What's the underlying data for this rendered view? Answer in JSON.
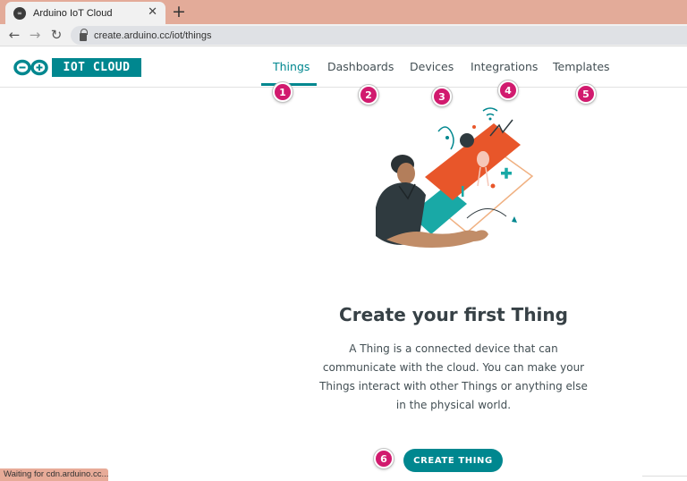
{
  "browser": {
    "tab_title": "Arduino IoT Cloud",
    "favicon_text": "∞",
    "close_glyph": "✕",
    "new_tab_glyph": "+",
    "back_glyph": "←",
    "forward_glyph": "→",
    "reload_glyph": "↻",
    "url": "create.arduino.cc/iot/things"
  },
  "app": {
    "logo_text": "IOT CLOUD",
    "brand_color": "#00878f",
    "nav": [
      {
        "label": "Things",
        "active": true
      },
      {
        "label": "Dashboards",
        "active": false
      },
      {
        "label": "Devices",
        "active": false
      },
      {
        "label": "Integrations",
        "active": false
      },
      {
        "label": "Templates",
        "active": false
      }
    ]
  },
  "markers": [
    "1",
    "2",
    "3",
    "4",
    "5",
    "6"
  ],
  "marker_color": "#d11a6e",
  "empty_state": {
    "title": "Create your first Thing",
    "description": "A Thing is a connected device that can communicate with the cloud. You can make your Things interact with other Things or anything else in the physical world.",
    "button_label": "CREATE THING"
  },
  "status": {
    "text": "Waiting for cdn.arduino.cc..."
  }
}
